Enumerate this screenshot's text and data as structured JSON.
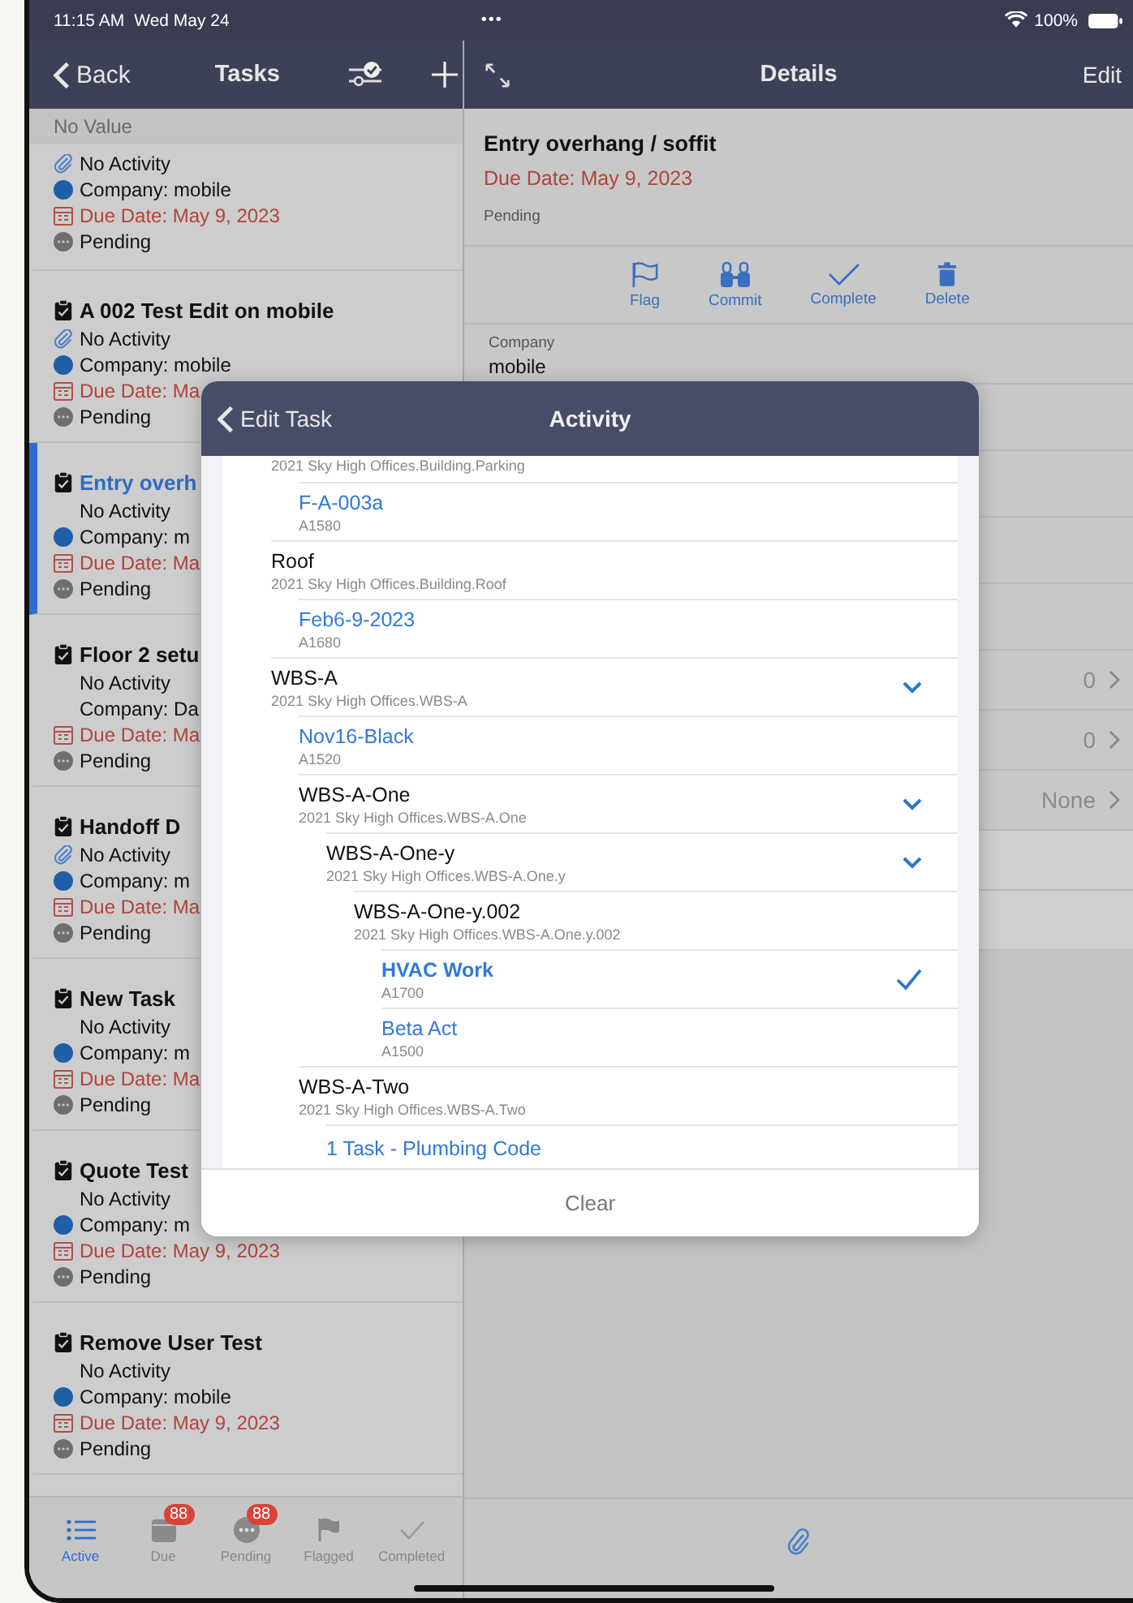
{
  "status_bar": {
    "time": "11:15 AM",
    "date": "Wed May 24",
    "dots": "•••",
    "battery": "100%"
  },
  "nav": {
    "back": "Back",
    "title": "Tasks"
  },
  "section_header": "No Value",
  "tasks": [
    {
      "attachment": true,
      "activity": "No Activity",
      "company": "Company: mobile",
      "company_dot": true,
      "due": "Due Date: May 9, 2023",
      "status": "Pending",
      "selected": false
    },
    {
      "title": "A 002 Test Edit on mobile",
      "attachment": true,
      "activity": "No Activity",
      "company": "Company: mobile",
      "company_dot": true,
      "due": "Due Date: Ma",
      "status": "Pending",
      "selected": false
    },
    {
      "title": "Entry overh",
      "attachment": false,
      "activity": "No Activity",
      "company": "Company: m",
      "company_dot": true,
      "due": "Due Date: Ma",
      "status": "Pending",
      "selected": true
    },
    {
      "title": "Floor 2 setu",
      "attachment": false,
      "activity": "No Activity",
      "company": "Company: Da",
      "company_dot": false,
      "due": "Due Date: Ma",
      "status": "Pending",
      "selected": false
    },
    {
      "title": "Handoff D",
      "attachment": true,
      "activity": "No Activity",
      "company": "Company: m",
      "company_dot": true,
      "due": "Due Date: Ma",
      "status": "Pending",
      "selected": false
    },
    {
      "title": "New Task",
      "attachment": false,
      "activity": "No Activity",
      "company": "Company: m",
      "company_dot": true,
      "due": "Due Date: Ma",
      "status": "Pending",
      "selected": false
    },
    {
      "title": "Quote Test",
      "attachment": false,
      "activity": "No Activity",
      "company": "Company: m",
      "company_dot": true,
      "due": "Due Date: May 9, 2023",
      "status": "Pending",
      "selected": false
    },
    {
      "title": "Remove User Test",
      "attachment": false,
      "activity": "No Activity",
      "company": "Company: mobile",
      "company_dot": true,
      "due": "Due Date: May 9, 2023",
      "status": "Pending",
      "selected": false
    }
  ],
  "tab_bar": [
    {
      "kind": "list",
      "label": "Active",
      "selected": true
    },
    {
      "kind": "calendar",
      "label": "Due",
      "badge": "88",
      "selected": false
    },
    {
      "kind": "dots",
      "label": "Pending",
      "badge": "88",
      "selected": false
    },
    {
      "kind": "flag",
      "label": "Flagged",
      "selected": false
    },
    {
      "kind": "check",
      "label": "Completed",
      "selected": false
    }
  ],
  "details": {
    "nav_title": "Details",
    "edit": "Edit",
    "title": "Entry overhang / soffit",
    "due": "Due Date: May 9, 2023",
    "status": "Pending",
    "actions": [
      {
        "kind": "flag",
        "label": "Flag"
      },
      {
        "kind": "binoculars",
        "label": "Commit"
      },
      {
        "kind": "check",
        "label": "Complete"
      },
      {
        "kind": "trash",
        "label": "Delete"
      }
    ],
    "company_label": "Company",
    "company_value": "mobile",
    "rows": [
      {
        "value": "0"
      },
      {
        "value": "0"
      },
      {
        "value": "None"
      }
    ]
  },
  "modal": {
    "back": "Edit Task",
    "title": "Activity",
    "clear": "Clear",
    "tree": [
      {
        "kind": "group",
        "children": [
          {
            "kind": "wbs",
            "subtitle": "2021 Sky High Offices.Building.Parking",
            "expanded": false,
            "children": [
              {
                "kind": "activity",
                "title": "F-A-003a",
                "subtitle": "A1580",
                "selected": false
              }
            ]
          },
          {
            "kind": "wbs",
            "title": "Roof",
            "subtitle": "2021 Sky High Offices.Building.Roof",
            "expanded": false,
            "children": [
              {
                "kind": "activity",
                "title": "Feb6-9-2023",
                "subtitle": "A1680",
                "selected": false
              }
            ]
          }
        ]
      },
      {
        "kind": "wbs",
        "title": "WBS-A",
        "subtitle": "2021 Sky High Offices.WBS-A",
        "expanded": true,
        "children": [
          {
            "kind": "activity",
            "title": "Nov16-Black",
            "subtitle": "A1520",
            "selected": false
          },
          {
            "kind": "wbs",
            "title": "WBS-A-One",
            "subtitle": "2021 Sky High Offices.WBS-A.One",
            "expanded": true,
            "children": [
              {
                "kind": "wbs",
                "title": "WBS-A-One-y",
                "subtitle": "2021 Sky High Offices.WBS-A.One.y",
                "expanded": true,
                "children": [
                  {
                    "kind": "wbs",
                    "title": "WBS-A-One-y.002",
                    "subtitle": "2021 Sky High Offices.WBS-A.One.y.002",
                    "expanded": false,
                    "children": [
                      {
                        "kind": "activity",
                        "title": "HVAC Work",
                        "subtitle": "A1700",
                        "selected": true
                      },
                      {
                        "kind": "activity",
                        "title": "Beta Act",
                        "subtitle": "A1500",
                        "selected": false
                      }
                    ]
                  }
                ]
              }
            ]
          },
          {
            "kind": "wbs",
            "title": "WBS-A-Two",
            "subtitle": "2021 Sky High Offices.WBS-A.Two",
            "expanded": false,
            "children": [
              {
                "kind": "activity",
                "title": "1 Task - Plumbing Code",
                "selected": false
              }
            ]
          }
        ]
      }
    ]
  }
}
